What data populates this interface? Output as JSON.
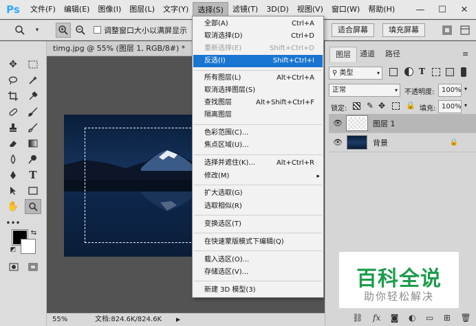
{
  "menubar": {
    "logo": "Ps",
    "items": [
      "文件(F)",
      "编辑(E)",
      "图像(I)",
      "图层(L)",
      "文字(Y)",
      "选择(S)",
      "滤镜(T)",
      "3D(D)",
      "视图(V)",
      "窗口(W)",
      "帮助(H)"
    ],
    "active_index": 5,
    "window_controls": [
      "—",
      "☐",
      "✕"
    ]
  },
  "options_bar": {
    "checkbox_label": "调整窗口大小以满屏显示",
    "fit_screen": "适合屏幕",
    "fill_screen": "填充屏幕"
  },
  "document": {
    "tab_title": "timg.jpg @ 55% (图层 1, RGB/8#) *",
    "zoom": "55%",
    "doc_info": "文档:824.6K/824.6K"
  },
  "select_menu": {
    "items": [
      {
        "label": "全部(A)",
        "shortcut": "Ctrl+A",
        "state": "normal"
      },
      {
        "label": "取消选择(D)",
        "shortcut": "Ctrl+D",
        "state": "normal"
      },
      {
        "label": "重新选择(E)",
        "shortcut": "Shift+Ctrl+D",
        "state": "disabled"
      },
      {
        "label": "反选(I)",
        "shortcut": "Shift+Ctrl+I",
        "state": "highlight"
      },
      {
        "label": "所有图层(L)",
        "shortcut": "Alt+Ctrl+A",
        "state": "normal"
      },
      {
        "label": "取消选择图层(S)",
        "shortcut": "",
        "state": "normal"
      },
      {
        "label": "查找图层",
        "shortcut": "Alt+Shift+Ctrl+F",
        "state": "normal"
      },
      {
        "label": "隔离图层",
        "shortcut": "",
        "state": "normal"
      },
      {
        "label": "色彩范围(C)...",
        "shortcut": "",
        "state": "normal"
      },
      {
        "label": "焦点区域(U)...",
        "shortcut": "",
        "state": "normal"
      },
      {
        "label": "选择并遮住(K)...",
        "shortcut": "Alt+Ctrl+R",
        "state": "normal"
      },
      {
        "label": "修改(M)",
        "shortcut": "▸",
        "state": "normal"
      },
      {
        "label": "扩大选取(G)",
        "shortcut": "",
        "state": "normal"
      },
      {
        "label": "选取相似(R)",
        "shortcut": "",
        "state": "normal"
      },
      {
        "label": "变换选区(T)",
        "shortcut": "",
        "state": "normal"
      },
      {
        "label": "在快速蒙版模式下编辑(Q)",
        "shortcut": "",
        "state": "normal"
      },
      {
        "label": "载入选区(O)...",
        "shortcut": "",
        "state": "normal"
      },
      {
        "label": "存储选区(V)...",
        "shortcut": "",
        "state": "normal"
      },
      {
        "label": "新建 3D 模型(3)",
        "shortcut": "",
        "state": "normal"
      }
    ]
  },
  "layers_panel": {
    "tabs": [
      "图层",
      "通道",
      "路径"
    ],
    "filter_kind": "类型",
    "blend_mode": "正常",
    "opacity_label": "不透明度:",
    "opacity_value": "100%",
    "lock_label": "锁定:",
    "fill_label": "填充:",
    "fill_value": "100%",
    "layers": [
      {
        "name": "图层 1",
        "selected": true
      },
      {
        "name": "背景",
        "selected": false
      }
    ]
  },
  "watermark": {
    "title": "百科全说",
    "subtitle": "助你轻松解决"
  },
  "colors": {
    "accent_highlight": "#1875d1",
    "ps_logo": "#31a8ff",
    "watermark_green": "#1c9c4c"
  }
}
